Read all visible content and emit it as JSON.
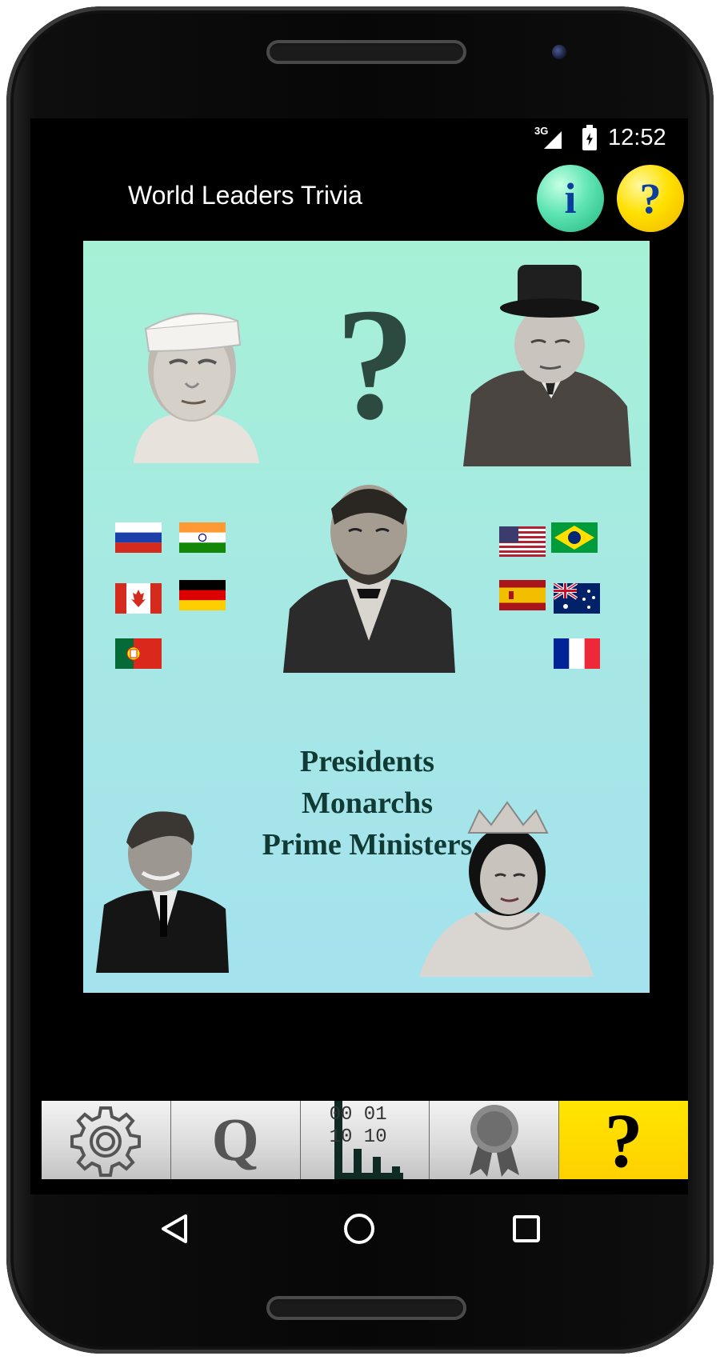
{
  "status_bar": {
    "network": "3G",
    "time": "12:52"
  },
  "app_bar": {
    "title": "World Leaders Trivia",
    "info_button": "i",
    "help_button": "?"
  },
  "hero": {
    "big_question_mark": "?",
    "tagline": [
      "Presidents",
      "Monarchs",
      "Prime Ministers"
    ],
    "portraits": [
      "leader-portrait-top-left",
      "leader-portrait-top-right",
      "leader-portrait-center",
      "leader-portrait-bottom-left",
      "leader-portrait-bottom-right"
    ],
    "flags_left": [
      "russia-flag",
      "india-flag",
      "canada-flag",
      "germany-flag",
      "portugal-flag"
    ],
    "flags_right": [
      "usa-flag",
      "brazil-flag",
      "spain-flag",
      "australia-flag",
      "france-flag"
    ]
  },
  "bottom_tabs": [
    {
      "name": "settings",
      "icon": "gear-icon"
    },
    {
      "name": "quiz",
      "label": "Q"
    },
    {
      "name": "stats",
      "icon": "binary-chart-icon",
      "label_top": "00 01",
      "label_bottom": "10 10"
    },
    {
      "name": "awards",
      "icon": "ribbon-icon"
    },
    {
      "name": "help",
      "label": "?"
    }
  ],
  "nav_bar": [
    "back-icon",
    "home-icon",
    "recents-icon"
  ],
  "colors": {
    "hero_top": "#a6f1d6",
    "hero_bottom": "#a4e2ee",
    "help_tab": "#ffd800",
    "info_button": "#3fd49c",
    "help_button": "#ffe000"
  }
}
